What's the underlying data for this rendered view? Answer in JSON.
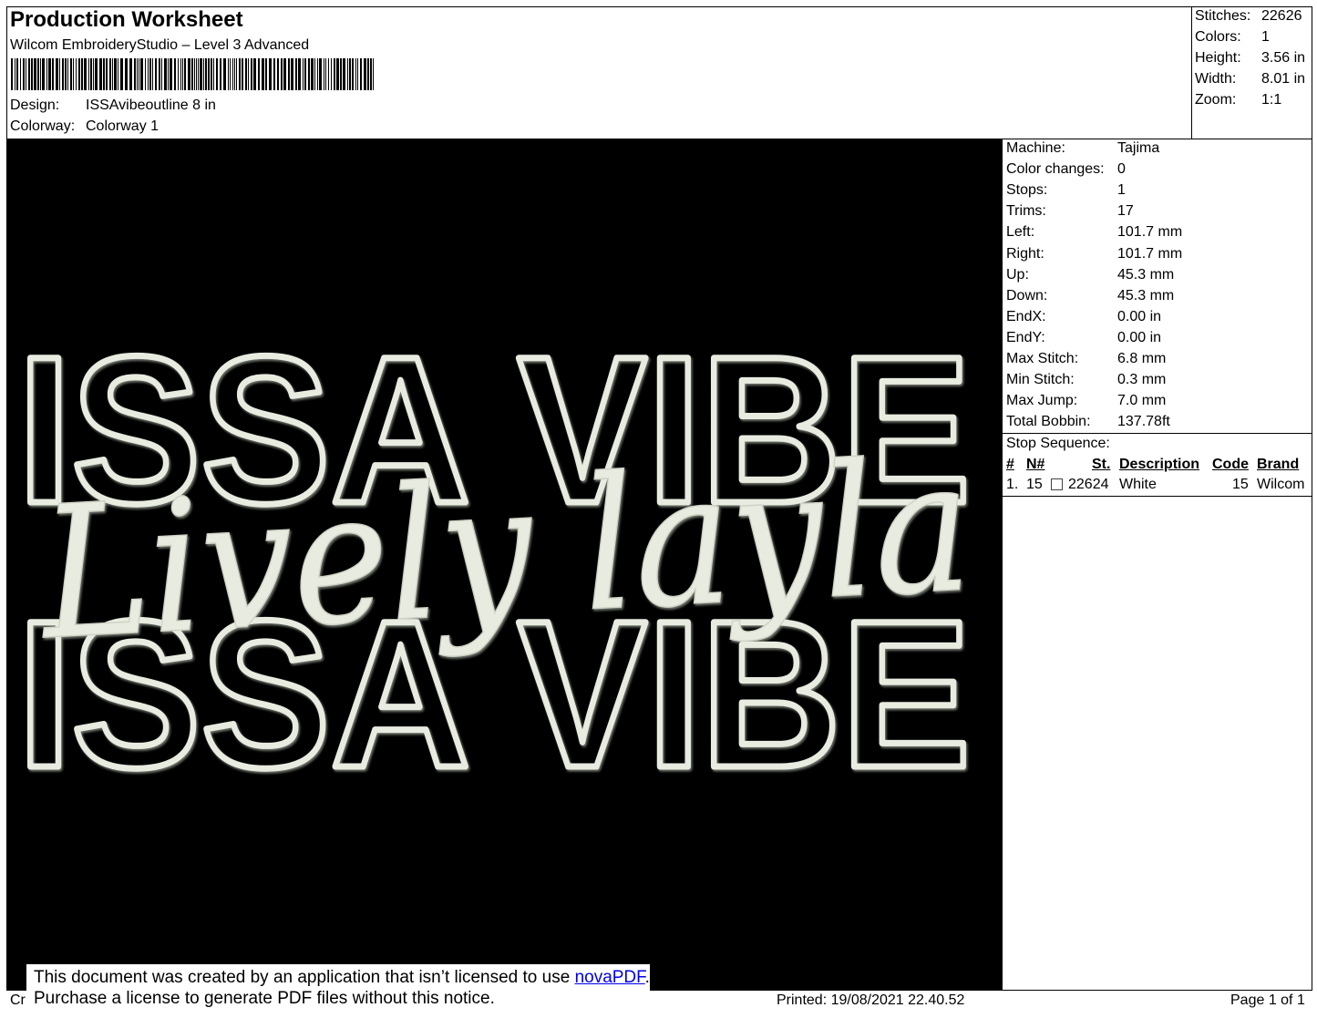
{
  "header": {
    "title": "Production Worksheet",
    "software": "Wilcom EmbroideryStudio – Level 3 Advanced",
    "design_label": "Design:",
    "design_value": "ISSAvibeoutline 8 in",
    "colorway_label": "Colorway:",
    "colorway_value": "Colorway 1"
  },
  "summary": [
    {
      "label": "Stitches:",
      "value": "22626"
    },
    {
      "label": "Colors:",
      "value": "1"
    },
    {
      "label": "Height:",
      "value": "3.56 in"
    },
    {
      "label": "Width:",
      "value": "8.01 in"
    },
    {
      "label": "Zoom:",
      "value": "1:1"
    }
  ],
  "machine_info": [
    {
      "label": "Machine:",
      "value": "Tajima"
    },
    {
      "label": "Color changes:",
      "value": "0"
    },
    {
      "label": "Stops:",
      "value": "1"
    },
    {
      "label": "Trims:",
      "value": "17"
    },
    {
      "label": "Left:",
      "value": "101.7 mm"
    },
    {
      "label": "Right:",
      "value": "101.7 mm"
    },
    {
      "label": "Up:",
      "value": "45.3 mm"
    },
    {
      "label": "Down:",
      "value": "45.3 mm"
    },
    {
      "label": "EndX:",
      "value": "0.00 in"
    },
    {
      "label": "EndY:",
      "value": "0.00 in"
    },
    {
      "label": "Max Stitch:",
      "value": "6.8 mm"
    },
    {
      "label": "Min Stitch:",
      "value": "0.3 mm"
    },
    {
      "label": "Max Jump:",
      "value": "7.0 mm"
    },
    {
      "label": "Total Bobbin:",
      "value": "137.78ft"
    }
  ],
  "stop_sequence": {
    "title": "Stop Sequence:",
    "headers": {
      "num": "#",
      "needle": "N#",
      "stitches": "St.",
      "description": "Description",
      "code": "Code",
      "brand": "Brand"
    },
    "rows": [
      {
        "num": "1.",
        "needle": "15",
        "stitches": "22624",
        "description": "White",
        "code": "15",
        "brand": "Wilcom"
      }
    ]
  },
  "design_art": {
    "block_text": "ISSA VIBE",
    "script_text": "Lively layla",
    "thread_color": "#e8ebe0",
    "background": "#000000"
  },
  "notice": {
    "line1_prefix": "This document was created by an application that isn’t licensed to use ",
    "link": "novaPDF",
    "line1_suffix": ".",
    "line2": "Purchase a license to generate PDF files without this notice."
  },
  "footer": {
    "left_fragment": "Cr",
    "printed": "Printed: 19/08/2021 22.40.52",
    "page": "Page 1 of 1"
  }
}
